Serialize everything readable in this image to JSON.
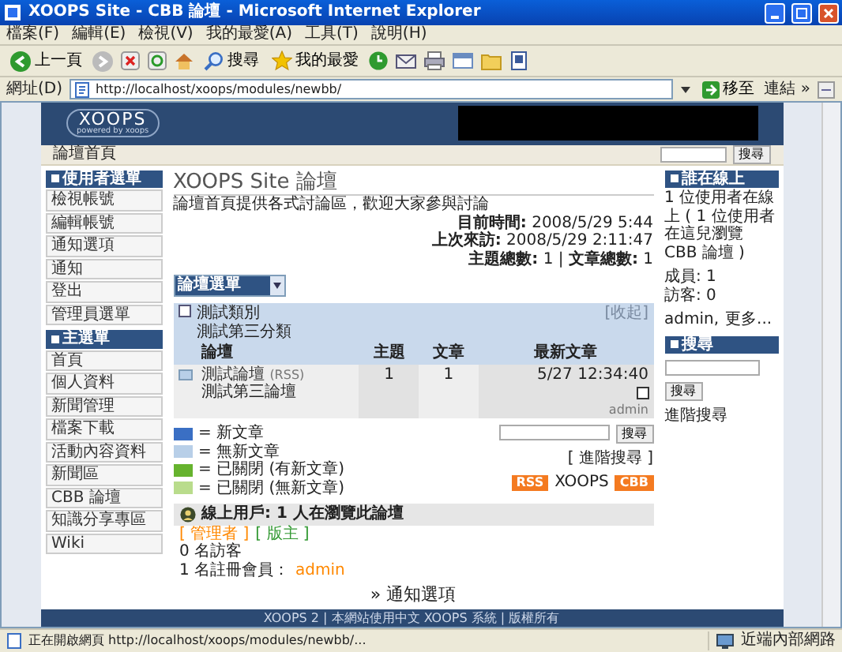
{
  "window": {
    "title": "XOOPS Site - CBB 論壇 - Microsoft Internet Explorer"
  },
  "menu": [
    "檔案(F)",
    "編輯(E)",
    "檢視(V)",
    "我的最愛(A)",
    "工具(T)",
    "說明(H)"
  ],
  "toolbar": {
    "back": "上一頁",
    "search": "搜尋",
    "favorites": "我的最愛"
  },
  "address": {
    "label": "網址(D)",
    "url": "http://localhost/xoops/modules/newbb/",
    "go": "移至",
    "links": "連結 »"
  },
  "site": {
    "logo": "XOOPS",
    "tagline": "powered by xoops"
  },
  "breadcrumb": "論壇首頁",
  "top_search": {
    "button": "搜尋"
  },
  "left_blocks": [
    {
      "title": "使用者選單",
      "items": [
        "檢視帳號",
        "編輯帳號",
        "通知選項",
        "通知",
        "登出",
        "管理員選單"
      ]
    },
    {
      "title": "主選單",
      "items": [
        "首頁",
        "個人資料",
        "新聞管理",
        "檔案下載",
        "活動內容資料",
        "新聞區",
        "CBB 論壇",
        "知識分享專區",
        "Wiki"
      ]
    }
  ],
  "main": {
    "title": "XOOPS Site 論壇",
    "description": "論壇首頁提供各式討論區，歡迎大家參與討論",
    "info": [
      "**目前時間:** 2008/5/29 5:44",
      "**上次來訪:** 2008/5/29 2:11:47",
      "**主題總數:** 1 | **文章總數:** 1"
    ],
    "jump": "論壇選單",
    "category": {
      "name": "測試類別",
      "description": "測試第三分類",
      "toggle": "[收起]"
    },
    "columns": [
      "論壇",
      "主題",
      "文章",
      "最新文章"
    ],
    "rows": [
      {
        "forum": "測試論壇",
        "rss": "(RSS)",
        "description": "測試第三論壇",
        "topics": "1",
        "posts": "1",
        "last_time": "5/27 12:34:40",
        "last_user": "admin"
      }
    ],
    "legend": [
      {
        "color": "#3a6fc4",
        "label": "= 新文章"
      },
      {
        "color": "#b8cfe8",
        "label": "= 無新文章"
      },
      {
        "color": "#66b32e",
        "label": "= 已關閉 (有新文章)"
      },
      {
        "color": "#b9dc8c",
        "label": "= 已關閉 (無新文章)"
      }
    ],
    "search": {
      "button": "搜尋",
      "advanced": "[ 進階搜尋 ]"
    },
    "badges": [
      "RSS",
      "CBB"
    ],
    "badge_caption": "XOOPS",
    "online": {
      "title": "線上用戶: 1 人在瀏覽此論壇",
      "roles": [
        {
          "label": "[ 管理者 ]",
          "color": "#ff8800"
        },
        {
          "label": "[ 版主 ]",
          "color": "#339933"
        }
      ],
      "guests": "0 名訪客",
      "members_text": "1 名註冊會員：",
      "member": "admin"
    },
    "notify": "» 通知選項"
  },
  "right_blocks": {
    "online_title": "誰在線上",
    "online_text": "1 位使用者在線上 ( 1 位使用者在這兒瀏覽 CBB 論壇 )",
    "members": "成員: 1",
    "guests": "訪客: 0",
    "user": "admin,",
    "more": "更多...",
    "search_title": "搜尋",
    "search_button": "搜尋",
    "advanced": "進階搜尋"
  },
  "footer": "XOOPS 2 | 本網站使用中文 XOOPS 系統 | 版權所有",
  "status_bar": {
    "text": "正在開啟網頁 http://localhost/xoops/modules/newbb/...",
    "zone": "近端內部網路"
  }
}
